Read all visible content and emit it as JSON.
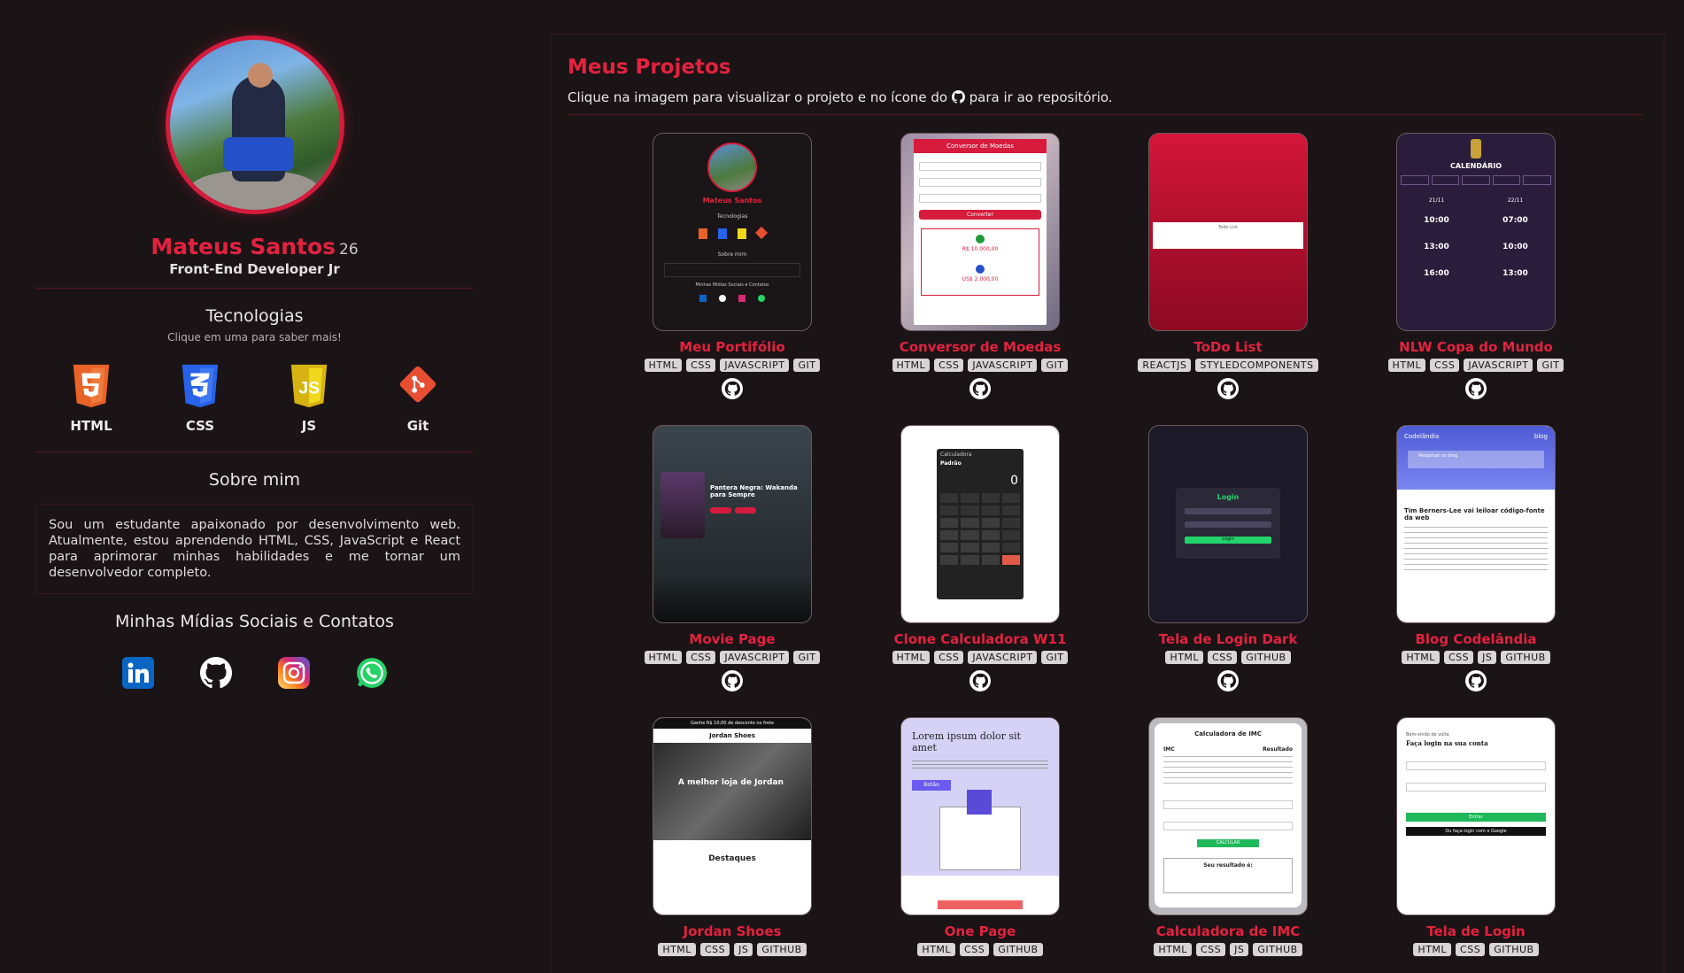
{
  "profile": {
    "name": "Mateus Santos",
    "age": "26",
    "role": "Front-End Developer Jr"
  },
  "technologies": {
    "title": "Tecnologias",
    "subtitle": "Clique em uma para saber mais!",
    "items": [
      {
        "label": "HTML",
        "icon": "html5-icon",
        "color": "#e96228"
      },
      {
        "label": "CSS",
        "icon": "css3-icon",
        "color": "#2862e9"
      },
      {
        "label": "JS",
        "icon": "js-icon",
        "color": "#efd81d"
      },
      {
        "label": "Git",
        "icon": "git-icon",
        "color": "#e84e31"
      }
    ]
  },
  "about": {
    "title": "Sobre mim",
    "text": "Sou um estudante apaixonado por desenvolvimento web. Atualmente, estou aprendendo HTML, CSS, JavaScript e React para aprimorar minhas habilidades e me tornar um desenvolvedor completo."
  },
  "social": {
    "title": "Minhas Mídias Sociais e Contatos",
    "items": [
      {
        "icon": "linkedin-icon",
        "color": "#0a66c2"
      },
      {
        "icon": "github-icon",
        "color": "#ffffff"
      },
      {
        "icon": "instagram-icon",
        "color": "#d62976"
      },
      {
        "icon": "whatsapp-icon",
        "color": "#25d366"
      }
    ]
  },
  "projects": {
    "title": "Meus Projetos",
    "subtitle_before": "Clique na imagem para visualizar o projeto e no ícone do",
    "subtitle_after": "para ir ao repositório.",
    "items": [
      {
        "title": "Meu Portifólio",
        "tags": [
          "HTML",
          "CSS",
          "JAVASCRIPT",
          "GIT"
        ]
      },
      {
        "title": "Conversor de Moedas",
        "tags": [
          "HTML",
          "CSS",
          "JAVASCRIPT",
          "GIT"
        ]
      },
      {
        "title": "ToDo List",
        "tags": [
          "REACTJS",
          "STYLEDCOMPONENTS"
        ]
      },
      {
        "title": "NLW Copa do Mundo",
        "tags": [
          "HTML",
          "CSS",
          "JAVASCRIPT",
          "GIT"
        ]
      },
      {
        "title": "Movie Page",
        "tags": [
          "HTML",
          "CSS",
          "JAVASCRIPT",
          "GIT"
        ]
      },
      {
        "title": "Clone Calculadora W11",
        "tags": [
          "HTML",
          "CSS",
          "JAVASCRIPT",
          "GIT"
        ]
      },
      {
        "title": "Tela de Login Dark",
        "tags": [
          "HTML",
          "CSS",
          "GITHUB"
        ]
      },
      {
        "title": "Blog Codelândia",
        "tags": [
          "HTML",
          "CSS",
          "JS",
          "GITHUB"
        ]
      },
      {
        "title": "Jordan Shoes",
        "tags": [
          "HTML",
          "CSS",
          "JS",
          "GITHUB"
        ]
      },
      {
        "title": "One Page",
        "tags": [
          "HTML",
          "CSS",
          "GITHUB"
        ]
      },
      {
        "title": "Calculadora de IMC",
        "tags": [
          "HTML",
          "CSS",
          "JS",
          "GITHUB"
        ]
      },
      {
        "title": "Tela de Login",
        "tags": [
          "HTML",
          "CSS",
          "GITHUB"
        ]
      }
    ]
  },
  "thumbs": {
    "portfolio": {
      "name": "Mateus Santos",
      "section1": "Tecnologias",
      "section2": "Sobre mim",
      "section3": "Minhas Mídias Sociais e Contatos"
    },
    "conversor": {
      "header": "Conversor de Moedas",
      "button": "Converter",
      "value1": "R$ 10.000,00",
      "value2": "US$ 2.000,00"
    },
    "todo": {
      "label": "Todo List"
    },
    "copa": {
      "title": "CALENDÁRIO",
      "date1": "21/11",
      "date2": "22/11",
      "time1": "10:00",
      "time2": "07:00",
      "time3": "13:00",
      "time4": "10:00",
      "time5": "16:00",
      "time6": "13:00"
    },
    "movie": {
      "title": "Pantera Negra: Wakanda para Sempre"
    },
    "calc": {
      "title": "Calculadora",
      "mode": "Padrão",
      "display": "0"
    },
    "loginDark": {
      "title": "Login",
      "button": "Login"
    },
    "blog": {
      "brand": "Codelândia",
      "link": "blog",
      "search": "Pesquisar no blog",
      "headline": "Tim Berners-Lee vai leiloar código-fonte da web"
    },
    "jordan": {
      "promo": "Ganhe R$ 10,00 de desconto no frete",
      "brand": "Jordan Shoes",
      "hero": "A melhor loja de Jordan",
      "section": "Destaques"
    },
    "one": {
      "heading": "Lorem ipsum dolor sit amet",
      "button": "Botão"
    },
    "imc": {
      "title": "Calculadora de IMC",
      "col1": "IMC",
      "col2": "Resultado",
      "button": "CALCULAR",
      "result": "Seu resultado é:"
    },
    "login": {
      "greeting": "Bem-vindo de volta",
      "title": "Faça login na sua conta",
      "button": "Entrar",
      "google": "Ou faça login com o Google"
    }
  }
}
